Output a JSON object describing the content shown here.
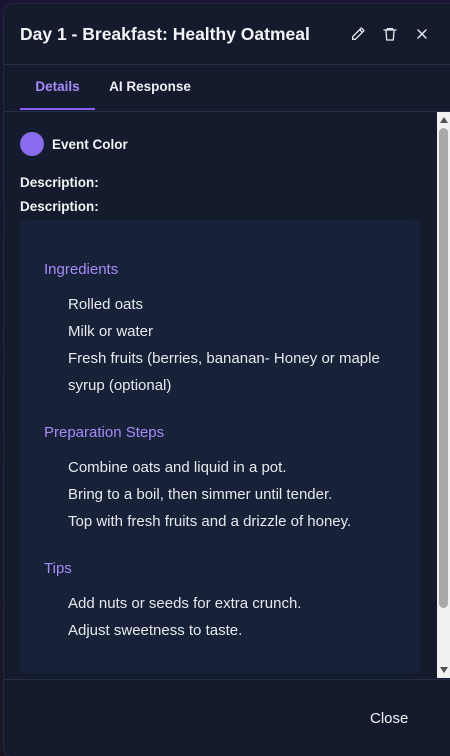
{
  "modal": {
    "title": "Day 1 - Breakfast: Healthy Oatmeal"
  },
  "tabs": [
    {
      "label": "Details",
      "active": true
    },
    {
      "label": "AI Response",
      "active": false
    }
  ],
  "event_color": {
    "label": "Event Color",
    "color": "#8b6cf0"
  },
  "description_labels": [
    "Description:",
    "Description:"
  ],
  "recipe": {
    "ingredients_title": "Ingredients",
    "ingredients": [
      "Rolled oats",
      "Milk or water",
      "Fresh fruits (berries, bananan- Honey or maple syrup (optional)"
    ],
    "steps_title": "Preparation Steps",
    "steps": [
      "Combine oats and liquid in a pot.",
      "Bring to a boil, then simmer until tender.",
      "Top with fresh fruits and a drizzle of honey."
    ],
    "tips_title": "Tips",
    "tips": [
      "Add nuts or seeds for extra crunch.",
      "Adjust sweetness to taste."
    ]
  },
  "footer": {
    "close_label": "Close"
  },
  "colors": {
    "accent": "#a78bfa",
    "tab_underline": "#8b5cf6",
    "modal_bg": "#141b2d",
    "card_bg": "#172138"
  }
}
